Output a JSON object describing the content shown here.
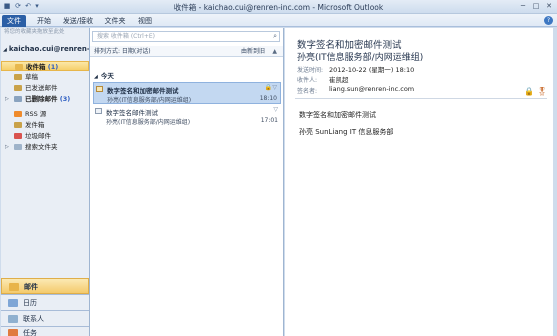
{
  "window": {
    "title": "收件箱 - kaichao.cui@renren-inc.com - Microsoft Outlook",
    "controls": [
      "minimize",
      "maximize",
      "close"
    ]
  },
  "ribbon": {
    "tabs": [
      "文件",
      "开始",
      "发送/接收",
      "文件夹",
      "视图"
    ]
  },
  "nav": {
    "hint": "将您的收藏夹拖放至此处",
    "account": "kaichao.cui@renren-inc.com",
    "folders": [
      {
        "label": "收件箱",
        "count": "(1)"
      },
      {
        "label": "草稿",
        "count": ""
      },
      {
        "label": "已发送邮件",
        "count": ""
      },
      {
        "label": "已删除邮件",
        "count": "(3)"
      },
      {
        "label": "RSS 源",
        "count": ""
      },
      {
        "label": "发件箱",
        "count": ""
      },
      {
        "label": "垃圾邮件",
        "count": ""
      },
      {
        "label": "搜索文件夹",
        "count": ""
      }
    ],
    "wunderbar": [
      "邮件",
      "日历",
      "联系人",
      "任务"
    ]
  },
  "list": {
    "search_placeholder": "搜索 收件箱 (Ctrl+E)",
    "sort_label": "排列方式: 日期(对话)",
    "sort_order": "由新到旧",
    "group": "今天",
    "messages": [
      {
        "subject": "数字签名和加密邮件测试",
        "from": "孙亮(IT信息服务部/内网运维组)",
        "time": "18:10"
      },
      {
        "subject": "数字签名邮件测试",
        "from": "孙亮(IT信息服务部/内网运维组)",
        "time": "17:01"
      }
    ]
  },
  "reading": {
    "subject": "数字签名和加密邮件测试",
    "from": "孙亮(IT信息服务部/内网运维组)",
    "sent_label": "发送时间:",
    "sent_value": "2012-10-22 (星期一) 18:10",
    "to_label": "收件人:",
    "to_value": "崔凯超",
    "sig_label": "签名者:",
    "sig_value": "liang.sun@renren-inc.com",
    "body_line1": "数字签名和加密邮件测试",
    "body_line2": "孙亮 SunLiang  IT 信息服务部"
  },
  "colors": {
    "file_tab": "#2b5fa6",
    "selection": "#c3d8f1",
    "folder_selection": "#f6cf6a",
    "count_blue": "#2d5dc1"
  }
}
